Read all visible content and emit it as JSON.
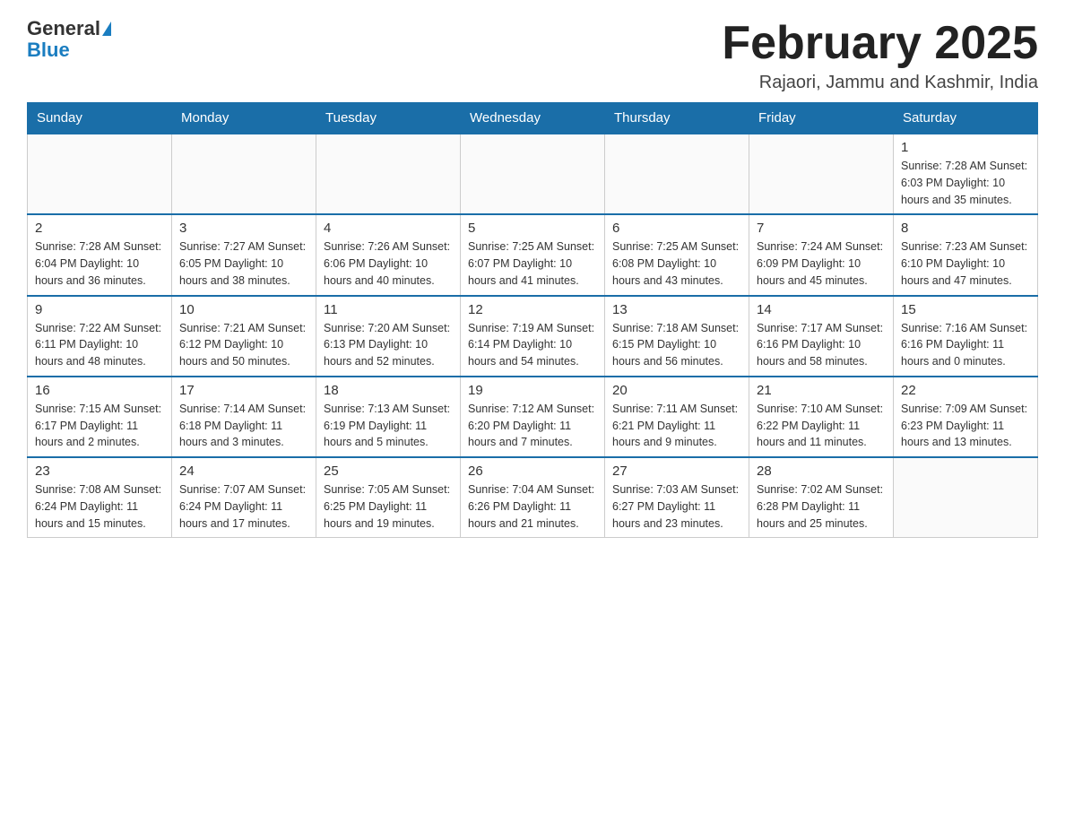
{
  "header": {
    "logo_general": "General",
    "logo_blue": "Blue",
    "title": "February 2025",
    "subtitle": "Rajaori, Jammu and Kashmir, India"
  },
  "weekdays": [
    "Sunday",
    "Monday",
    "Tuesday",
    "Wednesday",
    "Thursday",
    "Friday",
    "Saturday"
  ],
  "weeks": [
    [
      {
        "day": "",
        "info": ""
      },
      {
        "day": "",
        "info": ""
      },
      {
        "day": "",
        "info": ""
      },
      {
        "day": "",
        "info": ""
      },
      {
        "day": "",
        "info": ""
      },
      {
        "day": "",
        "info": ""
      },
      {
        "day": "1",
        "info": "Sunrise: 7:28 AM\nSunset: 6:03 PM\nDaylight: 10 hours\nand 35 minutes."
      }
    ],
    [
      {
        "day": "2",
        "info": "Sunrise: 7:28 AM\nSunset: 6:04 PM\nDaylight: 10 hours\nand 36 minutes."
      },
      {
        "day": "3",
        "info": "Sunrise: 7:27 AM\nSunset: 6:05 PM\nDaylight: 10 hours\nand 38 minutes."
      },
      {
        "day": "4",
        "info": "Sunrise: 7:26 AM\nSunset: 6:06 PM\nDaylight: 10 hours\nand 40 minutes."
      },
      {
        "day": "5",
        "info": "Sunrise: 7:25 AM\nSunset: 6:07 PM\nDaylight: 10 hours\nand 41 minutes."
      },
      {
        "day": "6",
        "info": "Sunrise: 7:25 AM\nSunset: 6:08 PM\nDaylight: 10 hours\nand 43 minutes."
      },
      {
        "day": "7",
        "info": "Sunrise: 7:24 AM\nSunset: 6:09 PM\nDaylight: 10 hours\nand 45 minutes."
      },
      {
        "day": "8",
        "info": "Sunrise: 7:23 AM\nSunset: 6:10 PM\nDaylight: 10 hours\nand 47 minutes."
      }
    ],
    [
      {
        "day": "9",
        "info": "Sunrise: 7:22 AM\nSunset: 6:11 PM\nDaylight: 10 hours\nand 48 minutes."
      },
      {
        "day": "10",
        "info": "Sunrise: 7:21 AM\nSunset: 6:12 PM\nDaylight: 10 hours\nand 50 minutes."
      },
      {
        "day": "11",
        "info": "Sunrise: 7:20 AM\nSunset: 6:13 PM\nDaylight: 10 hours\nand 52 minutes."
      },
      {
        "day": "12",
        "info": "Sunrise: 7:19 AM\nSunset: 6:14 PM\nDaylight: 10 hours\nand 54 minutes."
      },
      {
        "day": "13",
        "info": "Sunrise: 7:18 AM\nSunset: 6:15 PM\nDaylight: 10 hours\nand 56 minutes."
      },
      {
        "day": "14",
        "info": "Sunrise: 7:17 AM\nSunset: 6:16 PM\nDaylight: 10 hours\nand 58 minutes."
      },
      {
        "day": "15",
        "info": "Sunrise: 7:16 AM\nSunset: 6:16 PM\nDaylight: 11 hours\nand 0 minutes."
      }
    ],
    [
      {
        "day": "16",
        "info": "Sunrise: 7:15 AM\nSunset: 6:17 PM\nDaylight: 11 hours\nand 2 minutes."
      },
      {
        "day": "17",
        "info": "Sunrise: 7:14 AM\nSunset: 6:18 PM\nDaylight: 11 hours\nand 3 minutes."
      },
      {
        "day": "18",
        "info": "Sunrise: 7:13 AM\nSunset: 6:19 PM\nDaylight: 11 hours\nand 5 minutes."
      },
      {
        "day": "19",
        "info": "Sunrise: 7:12 AM\nSunset: 6:20 PM\nDaylight: 11 hours\nand 7 minutes."
      },
      {
        "day": "20",
        "info": "Sunrise: 7:11 AM\nSunset: 6:21 PM\nDaylight: 11 hours\nand 9 minutes."
      },
      {
        "day": "21",
        "info": "Sunrise: 7:10 AM\nSunset: 6:22 PM\nDaylight: 11 hours\nand 11 minutes."
      },
      {
        "day": "22",
        "info": "Sunrise: 7:09 AM\nSunset: 6:23 PM\nDaylight: 11 hours\nand 13 minutes."
      }
    ],
    [
      {
        "day": "23",
        "info": "Sunrise: 7:08 AM\nSunset: 6:24 PM\nDaylight: 11 hours\nand 15 minutes."
      },
      {
        "day": "24",
        "info": "Sunrise: 7:07 AM\nSunset: 6:24 PM\nDaylight: 11 hours\nand 17 minutes."
      },
      {
        "day": "25",
        "info": "Sunrise: 7:05 AM\nSunset: 6:25 PM\nDaylight: 11 hours\nand 19 minutes."
      },
      {
        "day": "26",
        "info": "Sunrise: 7:04 AM\nSunset: 6:26 PM\nDaylight: 11 hours\nand 21 minutes."
      },
      {
        "day": "27",
        "info": "Sunrise: 7:03 AM\nSunset: 6:27 PM\nDaylight: 11 hours\nand 23 minutes."
      },
      {
        "day": "28",
        "info": "Sunrise: 7:02 AM\nSunset: 6:28 PM\nDaylight: 11 hours\nand 25 minutes."
      },
      {
        "day": "",
        "info": ""
      }
    ]
  ]
}
